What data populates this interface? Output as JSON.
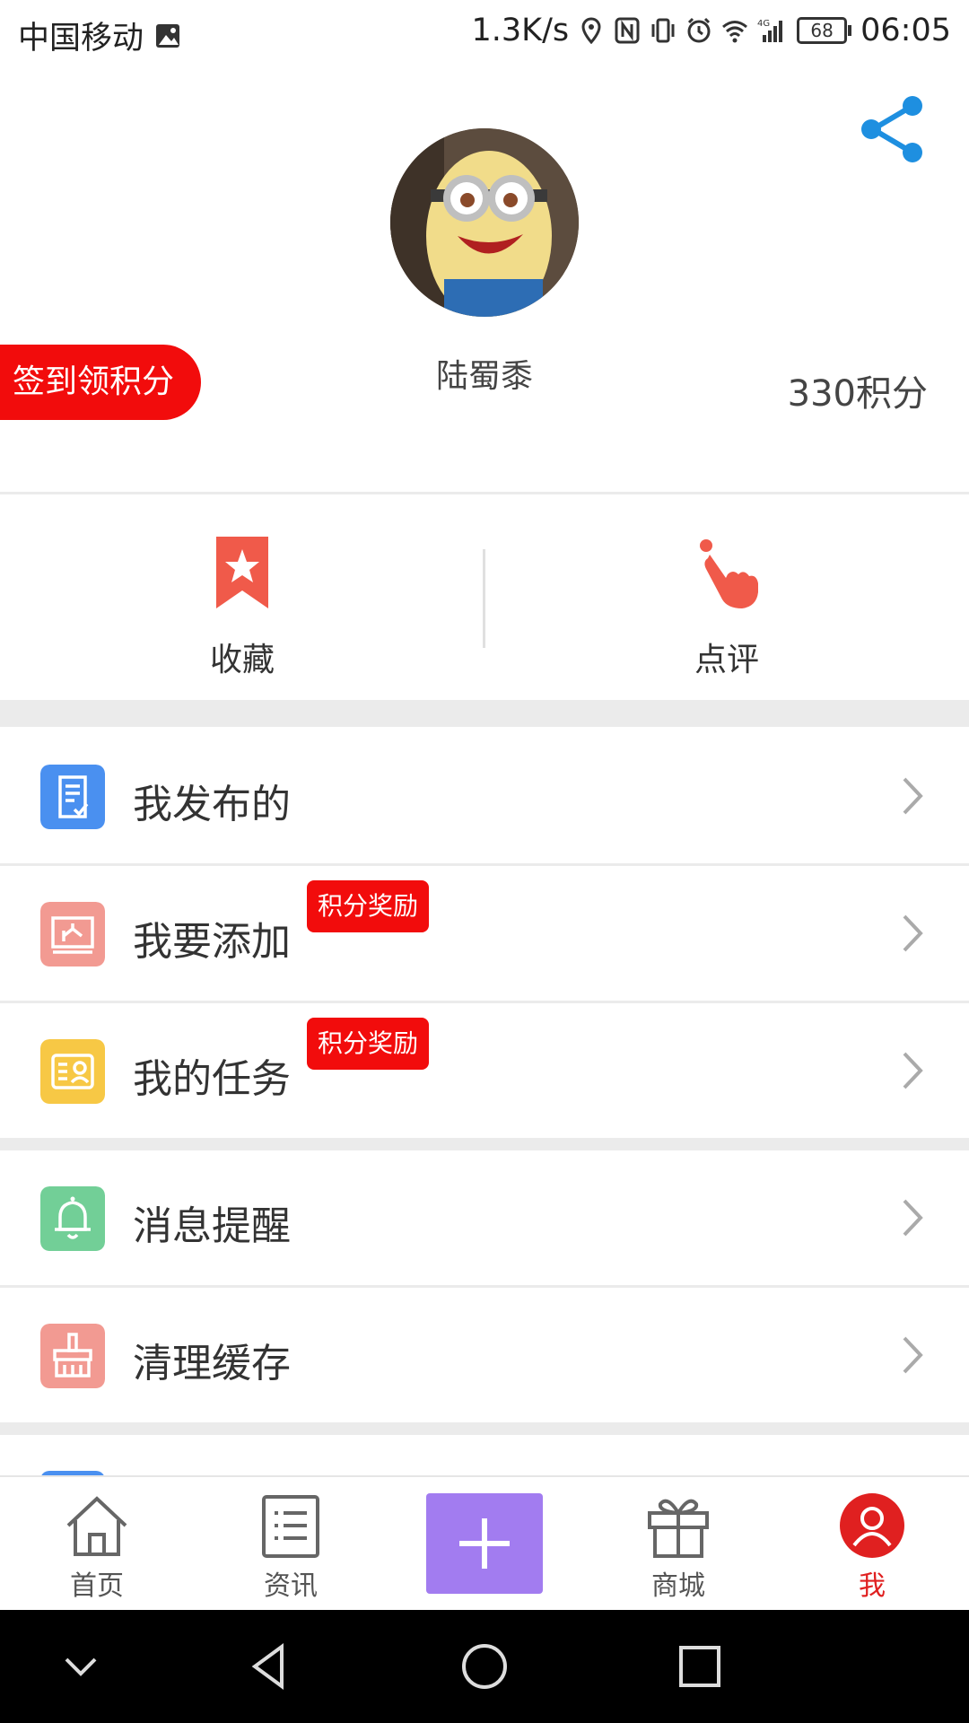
{
  "status_bar": {
    "carrier": "中国移动",
    "speed": "1.3K/s",
    "battery": "68",
    "time": "06:05"
  },
  "profile": {
    "username": "陆蜀黍",
    "checkin_label": "签到领积分",
    "points": "330积分"
  },
  "quick_actions": [
    {
      "label": "收藏",
      "icon": "bookmark-star-icon",
      "color": "#f05a4a"
    },
    {
      "label": "点评",
      "icon": "tap-hand-icon",
      "color": "#f05a4a"
    }
  ],
  "menu": [
    {
      "label": "我发布的",
      "icon": "document-check-icon",
      "color": "#4a90f0",
      "badge": ""
    },
    {
      "label": "我要添加",
      "icon": "image-add-icon",
      "color": "#f29a92",
      "badge": "积分奖励"
    },
    {
      "label": "我的任务",
      "icon": "task-card-icon",
      "color": "#f7c845",
      "badge": "积分奖励"
    },
    {
      "label": "消息提醒",
      "icon": "bell-icon",
      "color": "#72cf97",
      "badge": ""
    },
    {
      "label": "清理缓存",
      "icon": "broom-icon",
      "color": "#f29a92",
      "badge": ""
    }
  ],
  "tabs": [
    {
      "label": "首页",
      "icon": "home-icon"
    },
    {
      "label": "资讯",
      "icon": "news-list-icon"
    },
    {
      "label": "",
      "icon": "plus-icon"
    },
    {
      "label": "商城",
      "icon": "gift-icon"
    },
    {
      "label": "我",
      "icon": "user-icon"
    }
  ],
  "colors": {
    "accent_red": "#f20c0c",
    "tab_active": "#e02020",
    "add_button": "#a27cf0",
    "share_blue": "#1e8fe0"
  }
}
